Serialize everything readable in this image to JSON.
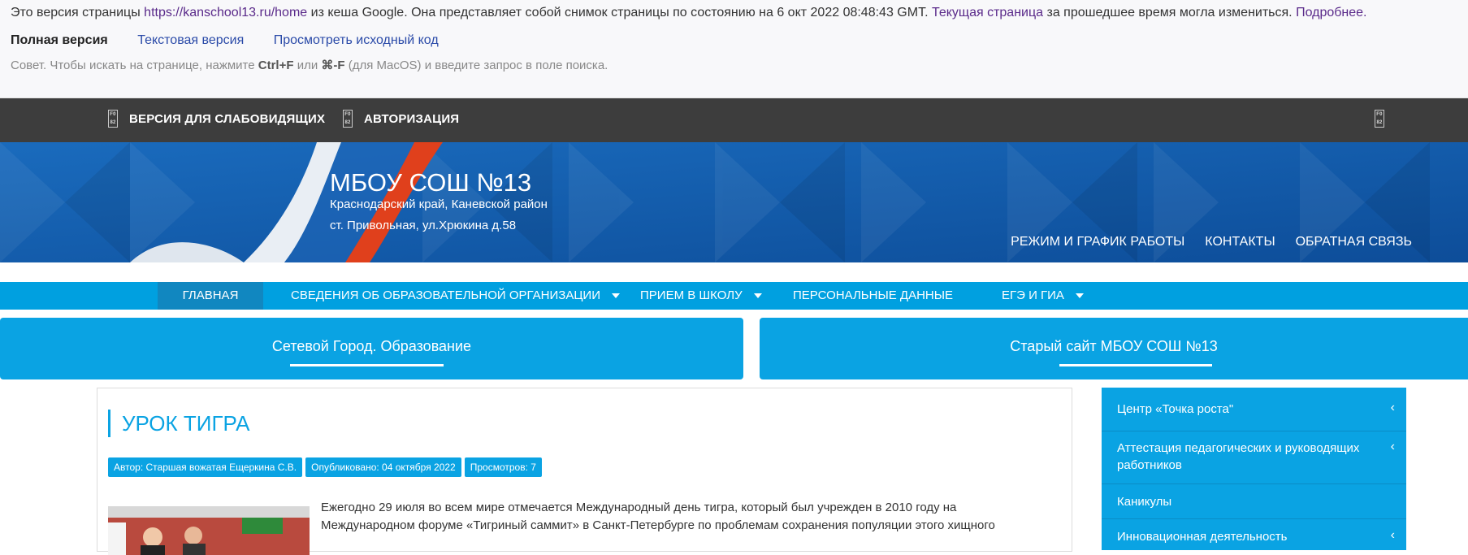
{
  "cache": {
    "prefix": "Это версия страницы ",
    "url": "https://kanschool13.ru/home",
    "middle": " из кеша Google. Она представляет собой снимок страницы по состоянию на 6 окт 2022 08:48:43 GMT. ",
    "current_link": "Текущая страница",
    "after": " за прошедшее время могла измениться. ",
    "more_link": "Подробнее.",
    "full_version": "Полная версия",
    "text_version": "Текстовая версия",
    "source_view": "Просмотреть исходный код",
    "tip_prefix": "Совет. Чтобы искать на странице, нажмите ",
    "tip_key1": "Ctrl+F",
    "tip_or": " или ",
    "tip_key2": "⌘-F",
    "tip_suffix": " (для MacOS) и введите запрос в поле поиска."
  },
  "topbar": {
    "low_vision": "ВЕРСИЯ ДЛЯ СЛАБОВИДЯЩИХ",
    "auth": "АВТОРИЗАЦИЯ",
    "icon_glyph": "F0 82"
  },
  "header": {
    "title": "МБОУ СОШ №13",
    "sub1": "Краснодарский край, Каневской район",
    "sub2": "ст. Привольная, ул.Хрюкина д.58",
    "links": [
      "РЕЖИМ И ГРАФИК РАБОТЫ",
      "КОНТАКТЫ",
      "ОБРАТНАЯ СВЯЗЬ"
    ]
  },
  "nav": {
    "home": "ГЛАВНАЯ",
    "info": "СВЕДЕНИЯ ОБ ОБРАЗОВАТЕЛЬНОЙ ОРГАНИЗАЦИИ",
    "admission": "ПРИЕМ В ШКОЛУ",
    "personal": "ПЕРСОНАЛЬНЫЕ ДАННЫЕ",
    "ege": "ЕГЭ И ГИА"
  },
  "buttons": {
    "left": "Сетевой Город. Образование",
    "right": "Старый сайт МБОУ СОШ №13"
  },
  "article": {
    "title": "УРОК ТИГРА",
    "author": "Автор: Старшая вожатая Ещеркина С.В.",
    "published": "Опубликовано: 04 октября 2022",
    "views": "Просмотров: 7",
    "text": "Ежегодно 29 июля во всем мире отмечается Международный день тигра, который был учрежден в 2010 году на Международном форуме «Тигриный саммит» в Санкт-Петербурге по проблемам сохранения популяции этого хищного"
  },
  "sidebar": {
    "items": [
      {
        "label": "Центр «Точка роста\""
      },
      {
        "label": "Аттестация педагогических и руководящих работников"
      },
      {
        "label": "Каникулы"
      },
      {
        "label": "Инновационная деятельность"
      }
    ]
  },
  "colors": {
    "accent": "#0aa3e3",
    "nav": "#00a0e0",
    "nav_active": "#1187c0",
    "topbar": "#3d3d3d",
    "banner": "#0f5aa8"
  }
}
